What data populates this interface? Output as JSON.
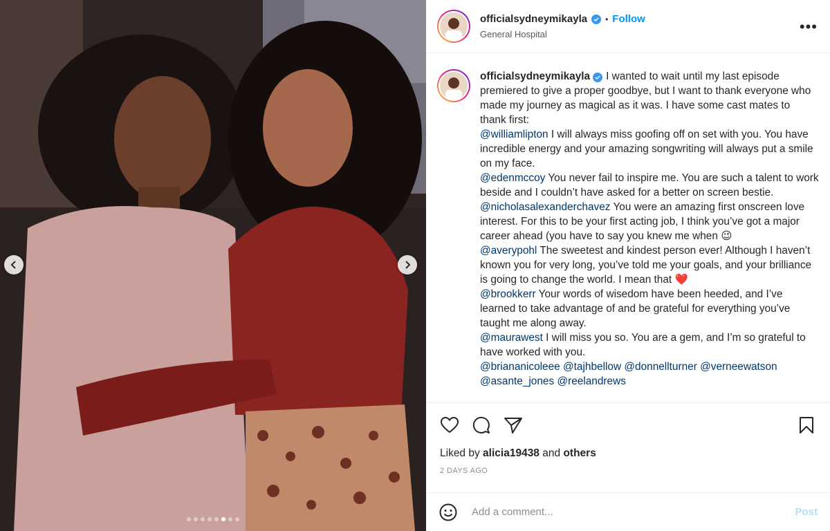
{
  "post": {
    "username": "officialsydneymikayla",
    "follow_label": "Follow",
    "location": "General Hospital",
    "more_label": "•••",
    "separator": "•"
  },
  "carousel": {
    "total_slides": 8,
    "active_slide": 6
  },
  "caption": {
    "username": "officialsydneymikayla",
    "intro": "I wanted to wait until my last episode premiered to give a proper goodbye, but I want to thank everyone who made my journey as magical as it was. I have some cast mates to thank first:",
    "items": [
      {
        "mention": "@williamlipton",
        "text": " I will always miss goofing off on set with you. You have incredible energy and your amazing songwriting will always put a smile on my face."
      },
      {
        "mention": "@edenmccoy",
        "text": " You never fail to inspire me. You are such a talent to work beside and I couldn’t have asked for a better on screen bestie."
      },
      {
        "mention": "@nicholasalexanderchavez",
        "text": " You were an amazing first onscreen love interest. For this to be your first acting job, I think you’ve got a major career ahead (you have to say you knew me when 😉"
      },
      {
        "mention": "@averypohl",
        "text": " The sweetest and kindest person ever! Although I haven’t known you for very long, you’ve told me your goals, and your brilliance is going to change the world. I mean that ❤️"
      },
      {
        "mention": "@brookkerr",
        "text": " Your words of wisedom have been heeded, and I’ve learned to take advantage of and be grateful for everything you’ve taught me along away."
      },
      {
        "mention": "@maurawest",
        "text": " I will miss you so. You are a gem, and I’m so grateful to have worked with you."
      }
    ],
    "tags": [
      "@briananicoleee",
      "@tajhbellow",
      "@donnellturner",
      "@verneewatson"
    ],
    "tags_cut": "@asante_jones @reelandrews"
  },
  "engagement": {
    "liked_prefix": "Liked by",
    "liked_user": "alicia19438",
    "liked_and": "and",
    "liked_others": "others",
    "time_ago": "2 DAYS AGO"
  },
  "comment_box": {
    "placeholder": "Add a comment...",
    "post_label": "Post"
  },
  "colors": {
    "link_blue": "#0095f6",
    "mention": "#00376b",
    "post_disabled": "#b2dffc"
  }
}
